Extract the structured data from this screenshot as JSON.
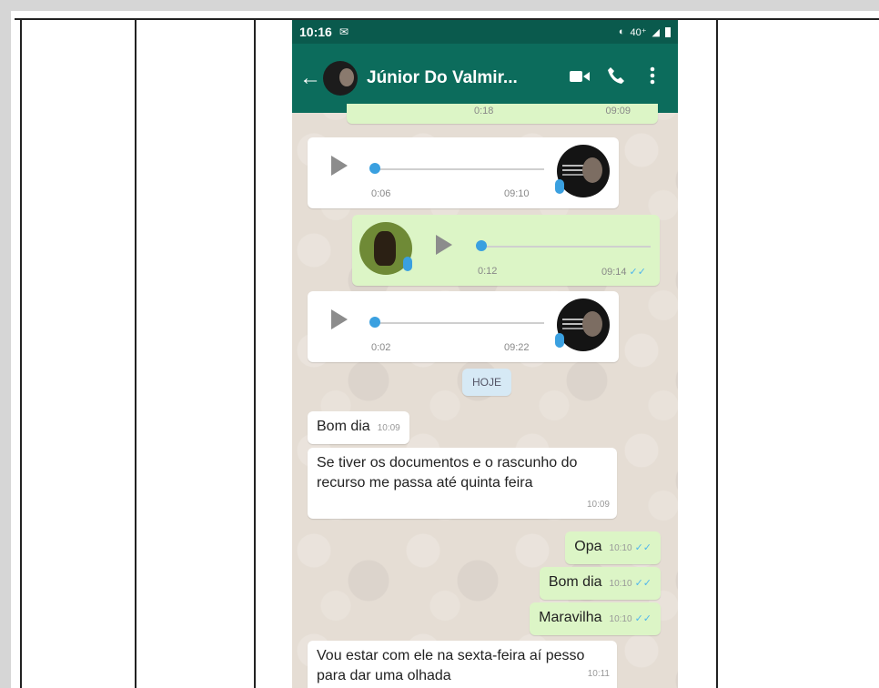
{
  "status_bar": {
    "time": "10:16",
    "env_icon": "✉",
    "network": "40⁺"
  },
  "chat_header": {
    "back_icon": "←",
    "contact_name": "Júnior Do Valmir...",
    "video_icon": "video-call-icon",
    "call_icon": "phone-icon",
    "menu_icon": "more-vert-icon"
  },
  "messages": {
    "partial_voice": {
      "duration": "0:18",
      "time": "09:09"
    },
    "voice_1": {
      "duration": "0:06",
      "time": "09:10"
    },
    "voice_2": {
      "duration": "0:12",
      "time": "09:14"
    },
    "voice_3": {
      "duration": "0:02",
      "time": "09:22"
    },
    "date_chip": "HOJE",
    "text_1": {
      "text": "Bom dia",
      "time": "10:09"
    },
    "text_2": {
      "text": "Se tiver os documentos e o rascunho do recurso me passa até quinta feira",
      "time": "10:09"
    },
    "text_3": {
      "text": "Opa",
      "time": "10:10"
    },
    "text_4": {
      "text": "Bom dia",
      "time": "10:10"
    },
    "text_5": {
      "text": "Maravilha",
      "time": "10:10"
    },
    "text_6": {
      "text": "Vou estar com ele na sexta-feira aí pesso para dar uma olhada",
      "time": "10:11"
    }
  },
  "colors": {
    "header": "#0c6c5c",
    "outgoing_bubble": "#dcf5c6",
    "incoming_bubble": "#ffffff",
    "read_ticks": "#4fb6ec"
  }
}
